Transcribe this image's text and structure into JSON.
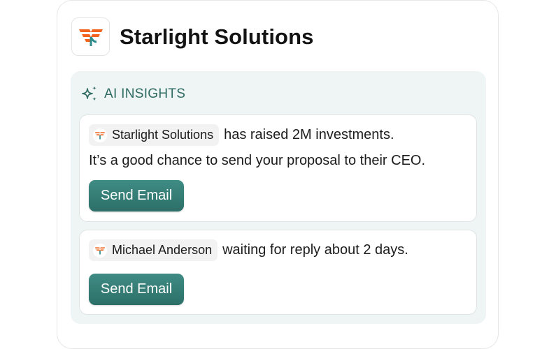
{
  "company": {
    "name": "Starlight Solutions",
    "logo_icon": "starlight-logo-icon",
    "logo_colors": {
      "orange": "#f0641f",
      "teal": "#2c8a8a"
    }
  },
  "insights": {
    "title": "AI INSIGHTS",
    "icon": "sparkles-icon",
    "accent_color": "#2f6b63",
    "items": [
      {
        "chip_label": "Starlight Solutions",
        "chip_icon": "starlight-logo-icon",
        "text": "has raised 2M investments.",
        "detail": "It’s a good chance to send your proposal to their CEO.",
        "button_label": "Send Email"
      },
      {
        "chip_label": "Michael Anderson",
        "chip_icon": "starlight-logo-icon",
        "text": "waiting for reply about 2 days.",
        "button_label": "Send Email"
      }
    ]
  },
  "colors": {
    "button": "#357d76",
    "panel": "#eef5f4"
  }
}
